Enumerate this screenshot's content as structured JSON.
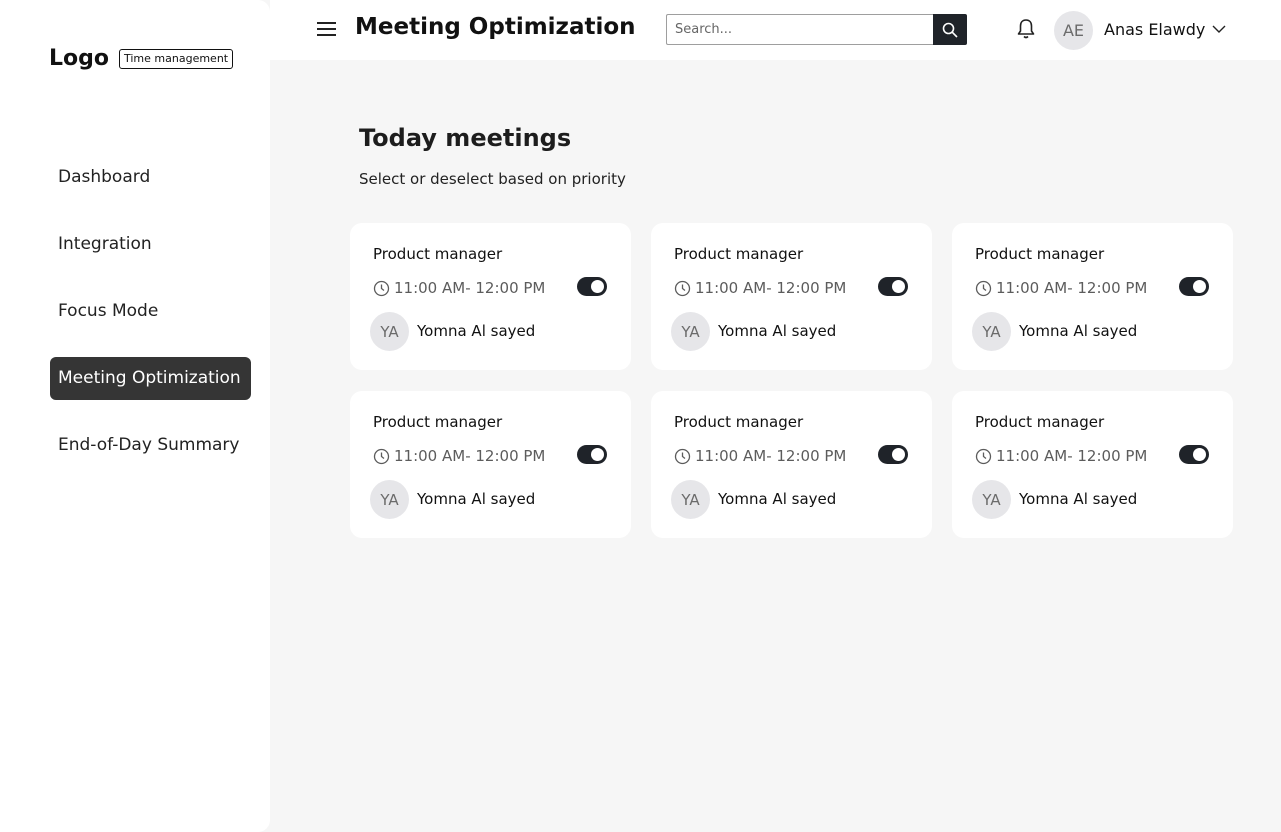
{
  "sidebar": {
    "logo": "Logo",
    "tag": "Time management",
    "items": [
      {
        "label": "Dashboard",
        "active": false
      },
      {
        "label": "Integration",
        "active": false
      },
      {
        "label": "Focus Mode",
        "active": false
      },
      {
        "label": "Meeting Optimization",
        "active": true
      },
      {
        "label": "End-of-Day Summary",
        "active": false
      }
    ]
  },
  "header": {
    "title": "Meeting Optimization",
    "search_placeholder": "Search...",
    "user": {
      "initials": "AE",
      "name": "Anas Elawdy"
    }
  },
  "main": {
    "title": "Today meetings",
    "subtitle": "Select or deselect based on priority",
    "meetings": [
      {
        "title": "Product manager",
        "time": "11:00 AM- 12:00 PM",
        "initials": "YA",
        "person": "Yomna Al sayed",
        "selected": true
      },
      {
        "title": "Product manager",
        "time": "11:00 AM- 12:00 PM",
        "initials": "YA",
        "person": "Yomna Al sayed",
        "selected": true
      },
      {
        "title": "Product manager",
        "time": "11:00 AM- 12:00 PM",
        "initials": "YA",
        "person": "Yomna Al sayed",
        "selected": true
      },
      {
        "title": "Product manager",
        "time": "11:00 AM- 12:00 PM",
        "initials": "YA",
        "person": "Yomna Al sayed",
        "selected": true
      },
      {
        "title": "Product manager",
        "time": "11:00 AM- 12:00 PM",
        "initials": "YA",
        "person": "Yomna Al sayed",
        "selected": true
      },
      {
        "title": "Product manager",
        "time": "11:00 AM- 12:00 PM",
        "initials": "YA",
        "person": "Yomna Al sayed",
        "selected": true
      }
    ]
  },
  "colors": {
    "accent": "#353535",
    "toggle_on": "#1f2329",
    "page_bg": "#f6f6f6",
    "card_bg": "#ffffff"
  }
}
